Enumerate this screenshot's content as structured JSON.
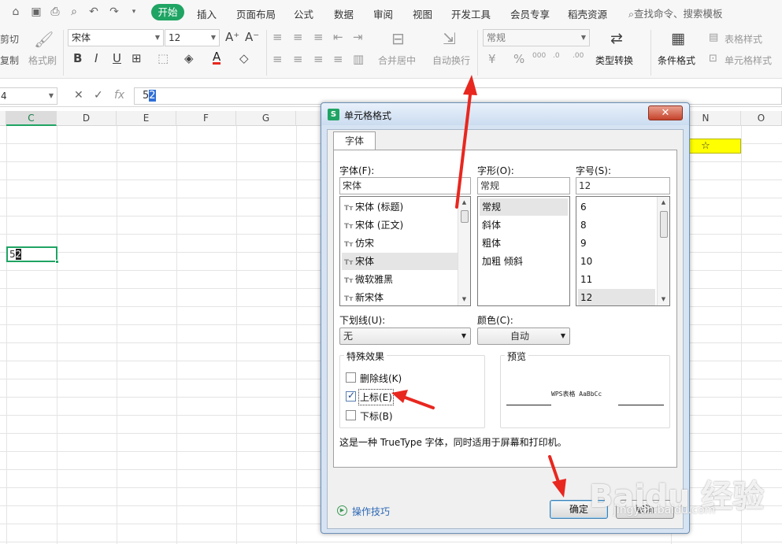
{
  "menubar": {
    "tabs": [
      "开始",
      "插入",
      "页面布局",
      "公式",
      "数据",
      "审阅",
      "视图",
      "开发工具",
      "会员专享",
      "稻壳资源"
    ],
    "active_tab": "开始",
    "search": "查找命令、搜索模板"
  },
  "ribbon": {
    "cut": "剪切",
    "copy": "复制",
    "format_painter": "格式刷",
    "font_name": "宋体",
    "font_size": "12",
    "merge_center": "合并居中",
    "wrap_text": "自动换行",
    "number_format": "常规",
    "type_convert": "类型转换",
    "conditional_format": "条件格式",
    "table_style": "表格样式",
    "cell_style": "单元格样式"
  },
  "formula_bar": {
    "name_box": "4",
    "fx": "fx",
    "content_prefix": "5",
    "content_selected": "2"
  },
  "columns": [
    "C",
    "D",
    "E",
    "F",
    "G",
    "N",
    "O"
  ],
  "cells": {
    "active_prefix": "5",
    "active_selected": "2",
    "star": "☆"
  },
  "dialog": {
    "title": "单元格格式",
    "tab": "字体",
    "font_label": "字体(F):",
    "font_value": "宋体",
    "fonts": [
      "宋体 (标题)",
      "宋体 (正文)",
      "仿宋",
      "宋体",
      "微软雅黑",
      "新宋体"
    ],
    "style_label": "字形(O):",
    "style_value": "常规",
    "styles": [
      "常规",
      "斜体",
      "粗体",
      "加粗 倾斜"
    ],
    "size_label": "字号(S):",
    "size_value": "12",
    "sizes": [
      "6",
      "8",
      "9",
      "10",
      "11",
      "12"
    ],
    "underline_label": "下划线(U):",
    "underline_value": "无",
    "color_label": "颜色(C):",
    "color_value": "自动",
    "effects_legend": "特殊效果",
    "strikethrough": "删除线(K)",
    "superscript": "上标(E)",
    "subscript": "下标(B)",
    "preview_legend": "预览",
    "preview_text": "WPS表格  AaBbCc",
    "info": "这是一种 TrueType 字体，同时适用于屏幕和打印机。",
    "tips": "操作技巧",
    "ok": "确定",
    "cancel": "取消"
  },
  "watermark": {
    "main": "Baidu 经验",
    "sub": "jingyan.baidu.com"
  },
  "colors": {
    "accent": "#1fa463",
    "arrow": "#e8271f",
    "highlight_cell": "#ffff00"
  }
}
